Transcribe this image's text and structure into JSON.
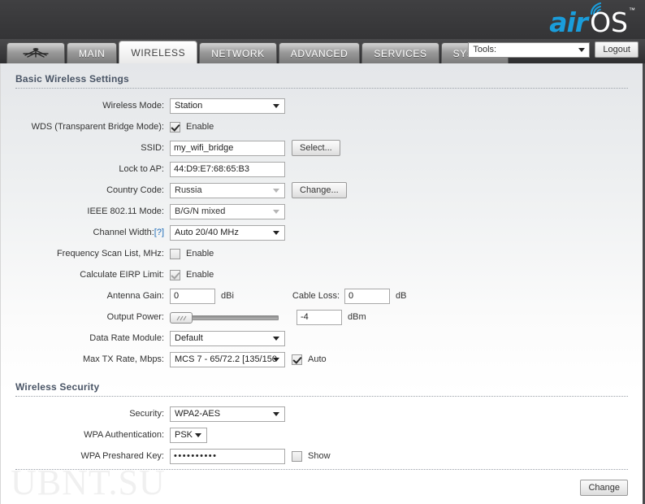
{
  "header": {
    "logo_air": "air",
    "logo_os": "OS",
    "logo_tm": "™",
    "wifi_icon": "wifi-signal-icon"
  },
  "tabs": {
    "logo_tab_name": "ubiquiti-logo-tab",
    "items": [
      {
        "label": "MAIN",
        "active": false
      },
      {
        "label": "WIRELESS",
        "active": true
      },
      {
        "label": "NETWORK",
        "active": false
      },
      {
        "label": "ADVANCED",
        "active": false
      },
      {
        "label": "SERVICES",
        "active": false
      },
      {
        "label": "SYSTEM",
        "active": false
      }
    ],
    "tools_label": "Tools:",
    "logout_label": "Logout"
  },
  "basic": {
    "title": "Basic Wireless Settings",
    "wireless_mode_label": "Wireless Mode:",
    "wireless_mode_value": "Station",
    "wds_label": "WDS (Transparent Bridge Mode):",
    "wds_enable_label": "Enable",
    "wds_checked": true,
    "ssid_label": "SSID:",
    "ssid_value": "my_wifi_bridge",
    "ssid_select_button": "Select...",
    "lock_ap_label": "Lock to AP:",
    "lock_ap_value": "44:D9:E7:68:65:B3",
    "country_label": "Country Code:",
    "country_value": "Russia",
    "country_change_button": "Change...",
    "ieee_label": "IEEE 802.11 Mode:",
    "ieee_value": "B/G/N mixed",
    "channel_width_label": "Channel Width:",
    "channel_width_help": "[?]",
    "channel_width_value": "Auto 20/40 MHz",
    "freq_scan_label": "Frequency Scan List, MHz:",
    "freq_scan_enable_label": "Enable",
    "freq_scan_checked": false,
    "eirp_label": "Calculate EIRP Limit:",
    "eirp_enable_label": "Enable",
    "eirp_checked": true,
    "antenna_gain_label": "Antenna Gain:",
    "antenna_gain_value": "0",
    "antenna_gain_unit": "dBi",
    "cable_loss_label": "Cable Loss:",
    "cable_loss_value": "0",
    "cable_loss_unit": "dB",
    "output_power_label": "Output Power:",
    "output_power_value": "-4",
    "output_power_unit": "dBm",
    "data_rate_label": "Data Rate Module:",
    "data_rate_value": "Default",
    "max_tx_label": "Max TX Rate, Mbps:",
    "max_tx_value": "MCS 7 - 65/72.2 [135/150",
    "max_tx_auto_label": "Auto",
    "max_tx_auto_checked": true
  },
  "security": {
    "title": "Wireless Security",
    "security_label": "Security:",
    "security_value": "WPA2-AES",
    "wpa_auth_label": "WPA Authentication:",
    "wpa_auth_value": "PSK",
    "psk_label": "WPA Preshared Key:",
    "psk_value": "••••••••••",
    "show_label": "Show",
    "show_checked": false
  },
  "footer": {
    "change_button": "Change",
    "watermark": "UBNT.SU"
  }
}
